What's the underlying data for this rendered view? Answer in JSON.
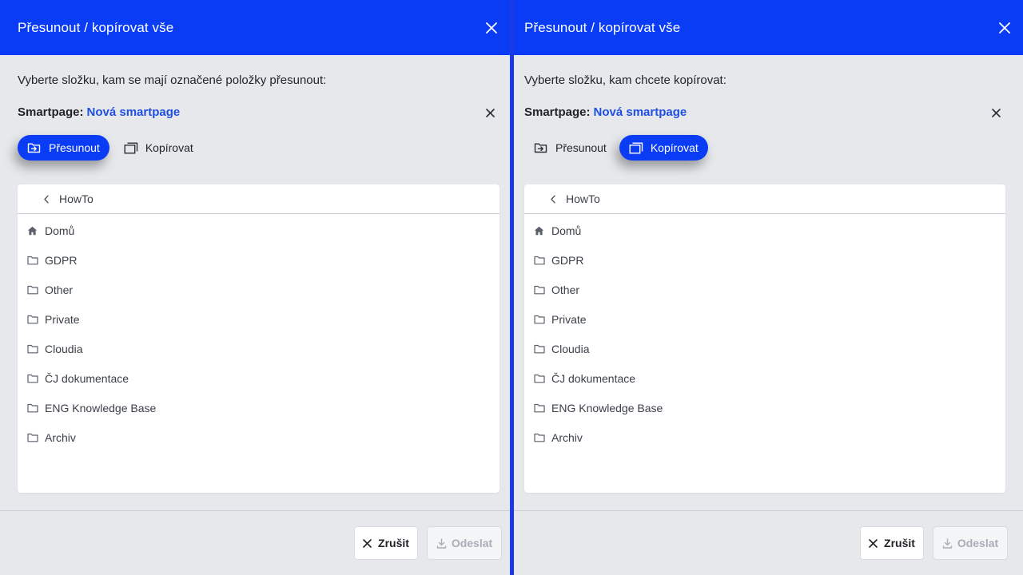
{
  "colors": {
    "accent": "#0b3cf5",
    "link": "#1f4fe0",
    "panel_bg": "#e6e8ec"
  },
  "left": {
    "title": "Přesunout / kopírovat vše",
    "instruction": "Vyberte složku, kam se mají označené položky přesunout:",
    "smartpage_label": "Smartpage:",
    "smartpage_value": "Nová smartpage",
    "mode_move": "Přesunout",
    "mode_copy": "Kopírovat",
    "active_mode": "move",
    "tree_back": "HowTo",
    "items": [
      {
        "label": "Domů",
        "icon": "home-icon"
      },
      {
        "label": "GDPR",
        "icon": "folder-icon"
      },
      {
        "label": "Other",
        "icon": "folder-icon"
      },
      {
        "label": "Private",
        "icon": "folder-icon"
      },
      {
        "label": "Cloudia",
        "icon": "folder-icon"
      },
      {
        "label": "ČJ dokumentace",
        "icon": "folder-icon"
      },
      {
        "label": "ENG Knowledge Base",
        "icon": "folder-icon"
      },
      {
        "label": "Archiv",
        "icon": "folder-icon"
      }
    ],
    "cancel": "Zrušit",
    "submit": "Odeslat"
  },
  "right": {
    "title": "Přesunout / kopírovat vše",
    "instruction": "Vyberte složku, kam chcete kopírovat:",
    "smartpage_label": "Smartpage:",
    "smartpage_value": "Nová smartpage",
    "mode_move": "Přesunout",
    "mode_copy": "Kopírovat",
    "active_mode": "copy",
    "tree_back": "HowTo",
    "items": [
      {
        "label": "Domů",
        "icon": "home-icon"
      },
      {
        "label": "GDPR",
        "icon": "folder-icon"
      },
      {
        "label": "Other",
        "icon": "folder-icon"
      },
      {
        "label": "Private",
        "icon": "folder-icon"
      },
      {
        "label": "Cloudia",
        "icon": "folder-icon"
      },
      {
        "label": "ČJ dokumentace",
        "icon": "folder-icon"
      },
      {
        "label": "ENG Knowledge Base",
        "icon": "folder-icon"
      },
      {
        "label": "Archiv",
        "icon": "folder-icon"
      }
    ],
    "cancel": "Zrušit",
    "submit": "Odeslat"
  }
}
